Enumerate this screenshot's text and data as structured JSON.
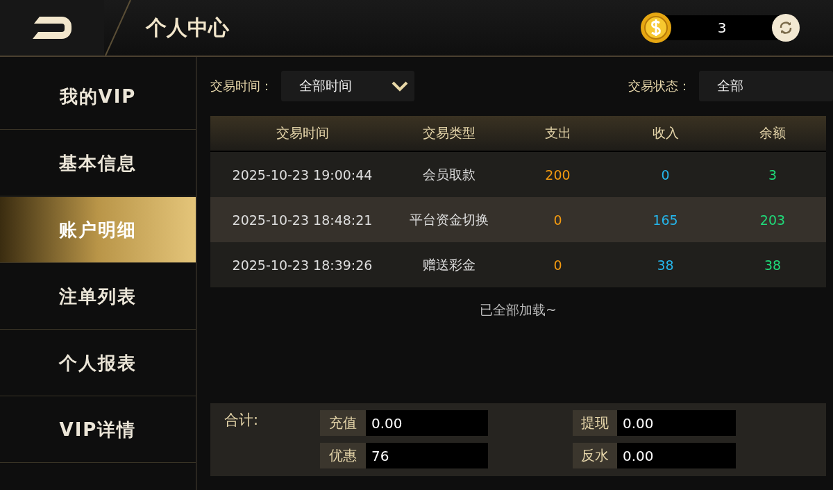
{
  "header": {
    "title": "个人中心",
    "balance": "3"
  },
  "sidebar": {
    "items": [
      {
        "label": "我的VIP",
        "selected": false
      },
      {
        "label": "基本信息",
        "selected": false
      },
      {
        "label": "账户明细",
        "selected": true
      },
      {
        "label": "注单列表",
        "selected": false
      },
      {
        "label": "个人报表",
        "selected": false
      },
      {
        "label": "VIP详情",
        "selected": false
      }
    ]
  },
  "filters": {
    "time_label": "交易时间：",
    "time_value": "全部时间",
    "status_label": "交易状态：",
    "status_value": "全部"
  },
  "table": {
    "columns": [
      "交易时间",
      "交易类型",
      "支出",
      "收入",
      "余额"
    ],
    "rows": [
      [
        "2025-10-23 19:00:44",
        "会员取款",
        "200",
        "0",
        "3"
      ],
      [
        "2025-10-23 18:48:21",
        "平台资金切换",
        "0",
        "165",
        "203"
      ],
      [
        "2025-10-23 18:39:26",
        "赠送彩金",
        "0",
        "38",
        "38"
      ]
    ]
  },
  "load_status": "已全部加载~",
  "totals": {
    "label": "合计:",
    "items": [
      {
        "label": "充值",
        "value": "0.00"
      },
      {
        "label": "提现",
        "value": "0.00"
      },
      {
        "label": "优惠",
        "value": "76"
      },
      {
        "label": "反水",
        "value": "0.00"
      }
    ]
  }
}
